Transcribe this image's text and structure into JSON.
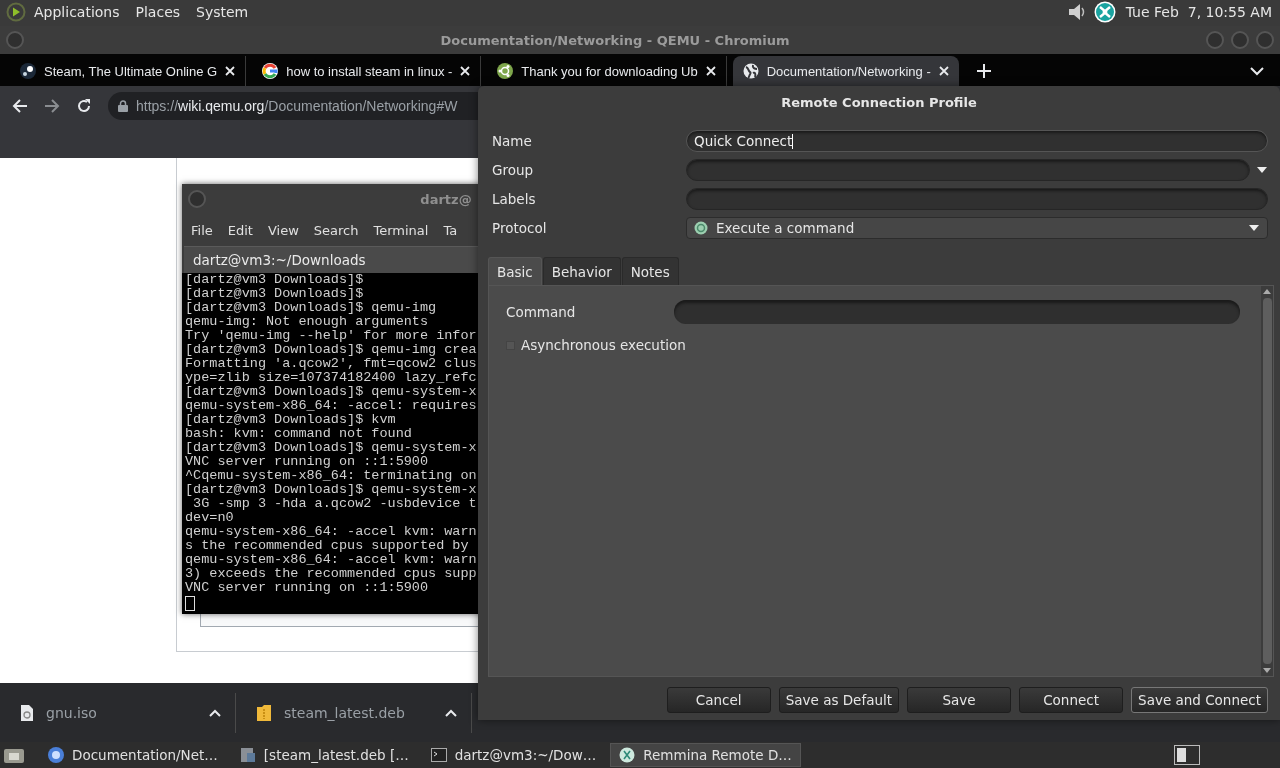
{
  "top_panel": {
    "menus": [
      "Applications",
      "Places",
      "System"
    ],
    "clock": "Tue Feb  7, 10:55 AM"
  },
  "browser": {
    "title": "Documentation/Networking - QEMU - Chromium",
    "tabs": [
      {
        "label": "Steam, The Ultimate Online G",
        "kind": "steam",
        "selected": false
      },
      {
        "label": "how to install steam in linux -",
        "kind": "search",
        "selected": false
      },
      {
        "label": "Thank you for downloading Ub",
        "kind": "distro",
        "selected": false
      },
      {
        "label": "Documentation/Networking -",
        "kind": "globe",
        "selected": true
      }
    ],
    "url": "https://**wiki.qemu.org**/Documentation/Networking#W"
  },
  "terminal": {
    "title": "dartz@",
    "menus": [
      "File",
      "Edit",
      "View",
      "Search",
      "Terminal",
      "Ta"
    ],
    "tab": "dartz@vm3:~/Downloads",
    "lines": [
      "[dartz@vm3 Downloads]$",
      "[dartz@vm3 Downloads]$",
      "[dartz@vm3 Downloads]$ qemu-img",
      "qemu-img: Not enough arguments",
      "Try 'qemu-img --help' for more infor",
      "[dartz@vm3 Downloads]$ qemu-img crea",
      "Formatting 'a.qcow2', fmt=qcow2 clus",
      "ype=zlib size=107374182400 lazy_refc",
      "[dartz@vm3 Downloads]$ qemu-system-x",
      "qemu-system-x86_64: -accel: requires",
      "[dartz@vm3 Downloads]$ kvm",
      "bash: kvm: command not found",
      "[dartz@vm3 Downloads]$ qemu-system-x",
      "VNC server running on ::1:5900",
      "^Cqemu-system-x86_64: terminating on",
      "[dartz@vm3 Downloads]$ qemu-system-x",
      " 3G -smp 3 -hda a.qcow2 -usbdevice t",
      "dev=n0",
      "qemu-system-x86_64: -accel kvm: warn",
      "s the recommended cpus supported by",
      "qemu-system-x86_64: -accel kvm: warn",
      "3) exceeds the recommended cpus supp",
      "VNC server running on ::1:5900"
    ]
  },
  "dialog": {
    "title": "Remote Connection Profile",
    "fields": [
      {
        "label": "Name",
        "kind": "entry",
        "value": "Quick Connect",
        "focused": true
      },
      {
        "label": "Group",
        "kind": "combo"
      },
      {
        "label": "Labels",
        "kind": "entry",
        "focused": false
      },
      {
        "label": "Protocol",
        "kind": "select",
        "value": "Execute a command"
      }
    ],
    "tabs": [
      {
        "label": "Basic",
        "selected": true
      },
      {
        "label": "Behavior",
        "selected": false
      },
      {
        "label": "Notes",
        "selected": false
      }
    ],
    "command_label": "Command",
    "async": {
      "label": "Asynchronous execution",
      "checked": false
    },
    "buttons": [
      "Cancel",
      "Save as Default",
      "Save",
      "Connect",
      "Save and Connect"
    ]
  },
  "downloads": [
    {
      "name": "gnu.iso",
      "kind": "file"
    },
    {
      "name": "steam_latest.deb",
      "kind": "package"
    }
  ],
  "taskbar": [
    {
      "label": "Documentation/Net…",
      "kind": "browser",
      "selected": false
    },
    {
      "label": "[steam_latest.deb […",
      "kind": "installer",
      "selected": false
    },
    {
      "label": "dartz@vm3:~/Dow…",
      "kind": "terminal",
      "selected": false
    },
    {
      "label": "Remmina Remote D…",
      "kind": "remote",
      "selected": true
    }
  ]
}
